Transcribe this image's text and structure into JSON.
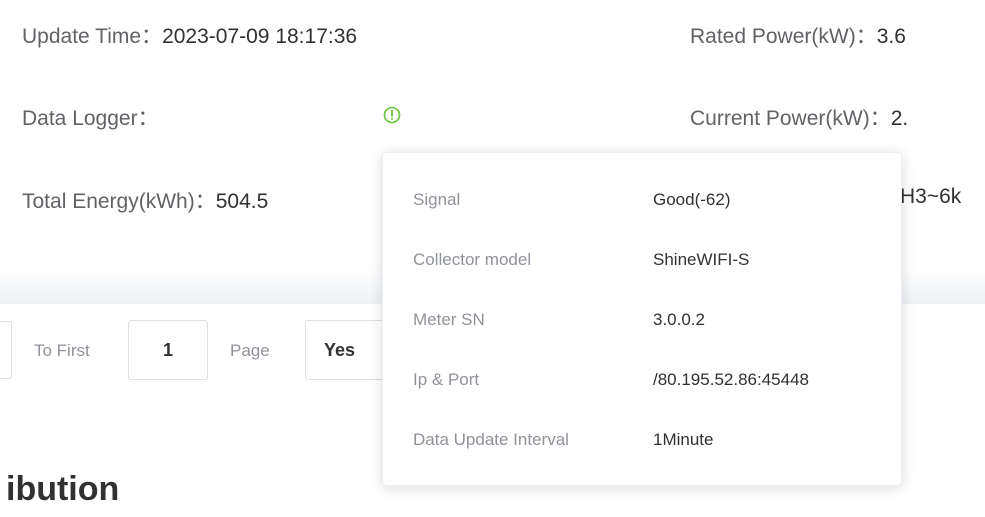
{
  "info": {
    "update_time_label": "Update Time：",
    "update_time_value": "2023-07-09 18:17:36",
    "rated_power_label": "Rated Power(kW)：",
    "rated_power_value": "3.6",
    "data_logger_label": "Data Logger：",
    "current_power_label": "Current Power(kW)：",
    "current_power_value": "2.",
    "total_energy_label": "Total Energy(kWh)：",
    "total_energy_value": "504.5",
    "model_partial": "PH3~6k"
  },
  "pager": {
    "to_first_label": "To First",
    "page_input_value": "1",
    "page_label": "Page",
    "yes_label": "Yes"
  },
  "section": {
    "title_partial": "ibution"
  },
  "popover": {
    "rows": [
      {
        "label": "Signal",
        "value": "Good(-62)"
      },
      {
        "label": "Collector model",
        "value": "ShineWIFI-S"
      },
      {
        "label": "Meter SN",
        "value": "3.0.0.2"
      },
      {
        "label": "Ip & Port",
        "value": "/80.195.52.86:45448"
      },
      {
        "label": "Data Update Interval",
        "value": "1Minute"
      }
    ]
  },
  "icons": {
    "logger_status": "info-circle-icon"
  },
  "colors": {
    "status_green": "#67c23a",
    "label_grey": "#606266",
    "value_dark": "#303133"
  }
}
